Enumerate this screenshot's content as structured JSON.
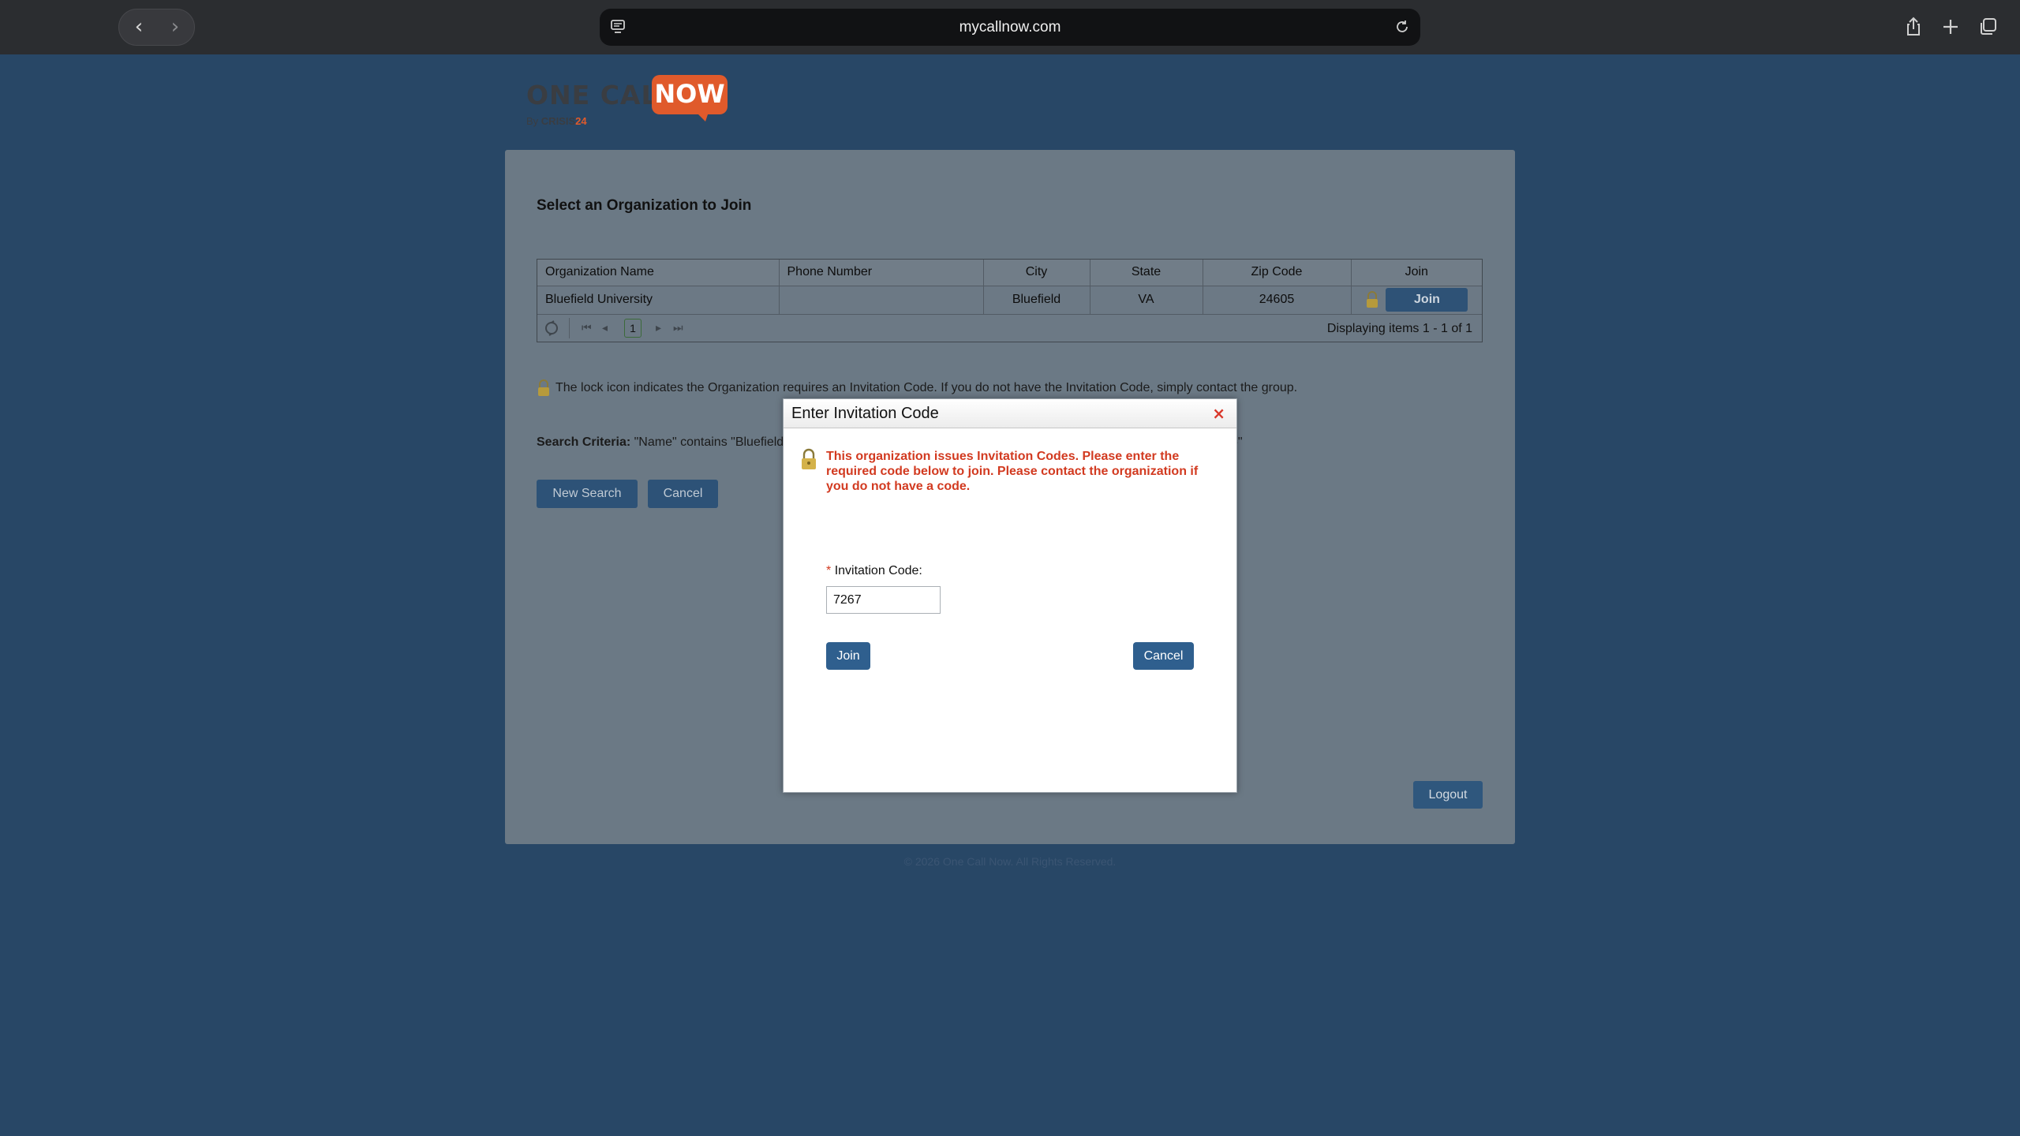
{
  "browser": {
    "url": "mycallnow.com",
    "back_glyph": "‹",
    "forward_glyph": "›"
  },
  "logo": {
    "main": "ONE CALL",
    "now": "NOW",
    "by": "By",
    "brand": "CRISIS",
    "brand_suffix": "24"
  },
  "page": {
    "title": "Select an Organization to Join",
    "columns": [
      "Organization Name",
      "Phone Number",
      "City",
      "State",
      "Zip Code",
      "Join"
    ],
    "rows": [
      {
        "name": "Bluefield University",
        "phone": "",
        "city": "Bluefield",
        "state": "VA",
        "zip": "24605",
        "join_label": "Join"
      }
    ],
    "pager": {
      "first": "⏮",
      "prev": "◂",
      "page": "1",
      "next": "▸",
      "last": "⏭",
      "display": "Displaying items 1 - 1 of 1"
    },
    "lock_note": "The lock icon indicates the Organization requires an Invitation Code. If you do not have the Invitation Code, simply contact the group.",
    "search_criteria_label": "Search Criteria:",
    "search_criteria_value": "\"Name\" contains \"Bluefield",
    "search_criteria_tail": "5\"",
    "new_search_label": "New Search",
    "cancel_label": "Cancel",
    "logout_label": "Logout",
    "copyright": "© 2026 One Call Now. All Rights Reserved."
  },
  "modal": {
    "title": "Enter Invitation Code",
    "close_glyph": "×",
    "message": "This organization issues Invitation Codes. Please enter the required code below to join. Please contact the organization if you do not have a code.",
    "required_mark": "*",
    "field_label": "Invitation Code:",
    "field_value": "7267",
    "join_label": "Join",
    "cancel_label": "Cancel"
  },
  "colors": {
    "page_bg": "#284766",
    "accent": "#e05a2b",
    "error_text": "#d23a20",
    "button_blue": "#2f5f8e"
  }
}
